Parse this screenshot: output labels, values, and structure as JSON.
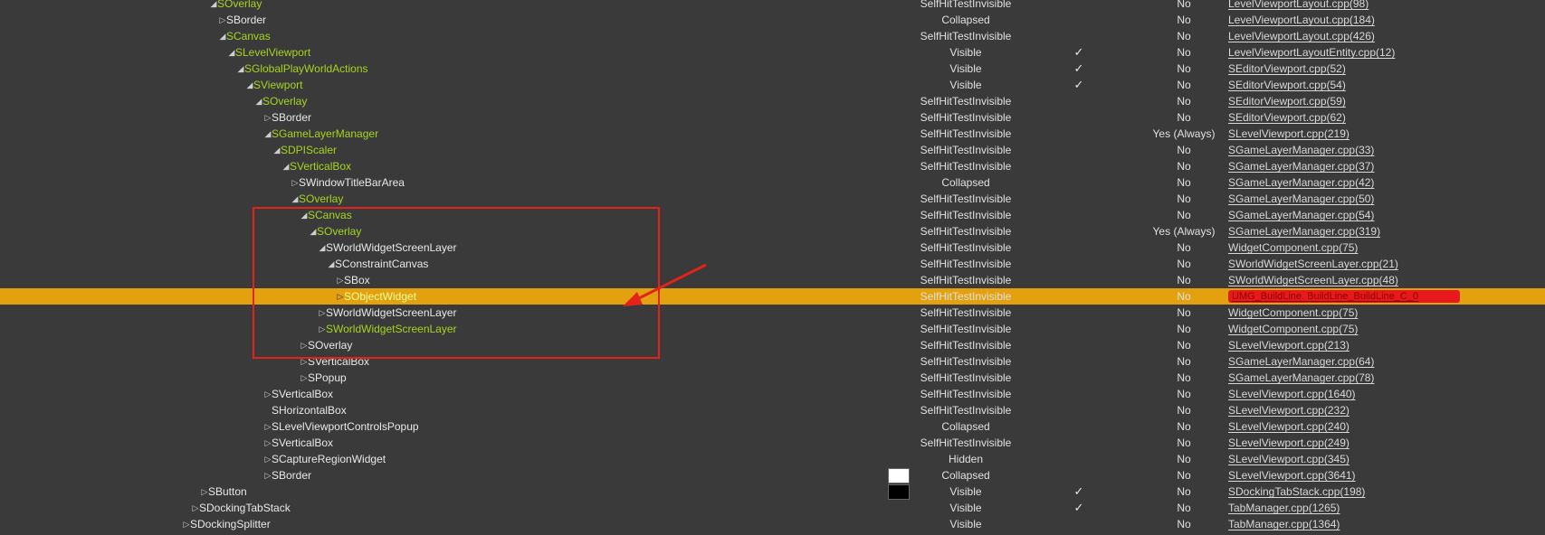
{
  "rows": [
    {
      "name": "SOverlay",
      "green": true,
      "level": 0,
      "exp": "down",
      "vis": "SelfHitTestInvisible",
      "check": "",
      "focus": "No",
      "src": "LevelViewportLayout.cpp(98)"
    },
    {
      "name": "SBorder",
      "green": false,
      "level": 1,
      "exp": "right",
      "vis": "Collapsed",
      "check": "",
      "focus": "No",
      "src": "LevelViewportLayout.cpp(184)"
    },
    {
      "name": "SCanvas",
      "green": true,
      "level": 1,
      "exp": "down",
      "vis": "SelfHitTestInvisible",
      "check": "",
      "focus": "No",
      "src": "LevelViewportLayout.cpp(426)"
    },
    {
      "name": "SLevelViewport",
      "green": true,
      "level": 2,
      "exp": "down",
      "vis": "Visible",
      "check": "✓",
      "focus": "No",
      "src": "LevelViewportLayoutEntity.cpp(12)"
    },
    {
      "name": "SGlobalPlayWorldActions",
      "green": true,
      "level": 3,
      "exp": "down",
      "vis": "Visible",
      "check": "✓",
      "focus": "No",
      "src": "SEditorViewport.cpp(52)"
    },
    {
      "name": "SViewport",
      "green": true,
      "level": 4,
      "exp": "down",
      "vis": "Visible",
      "check": "✓",
      "focus": "No",
      "src": "SEditorViewport.cpp(54)"
    },
    {
      "name": "SOverlay",
      "green": true,
      "level": 5,
      "exp": "down",
      "vis": "SelfHitTestInvisible",
      "check": "",
      "focus": "No",
      "src": "SEditorViewport.cpp(59)"
    },
    {
      "name": "SBorder",
      "green": false,
      "level": 6,
      "exp": "right",
      "vis": "SelfHitTestInvisible",
      "check": "",
      "focus": "No",
      "src": "SEditorViewport.cpp(62)"
    },
    {
      "name": "SGameLayerManager",
      "green": true,
      "level": 6,
      "exp": "down",
      "vis": "SelfHitTestInvisible",
      "check": "",
      "focus": "Yes (Always)",
      "src": "SLevelViewport.cpp(219)"
    },
    {
      "name": "SDPIScaler",
      "green": true,
      "level": 7,
      "exp": "down",
      "vis": "SelfHitTestInvisible",
      "check": "",
      "focus": "No",
      "src": "SGameLayerManager.cpp(33)"
    },
    {
      "name": "SVerticalBox",
      "green": true,
      "level": 8,
      "exp": "down",
      "vis": "SelfHitTestInvisible",
      "check": "",
      "focus": "No",
      "src": "SGameLayerManager.cpp(37)"
    },
    {
      "name": "SWindowTitleBarArea",
      "green": false,
      "level": 9,
      "exp": "right",
      "vis": "Collapsed",
      "check": "",
      "focus": "No",
      "src": "SGameLayerManager.cpp(42)"
    },
    {
      "name": "SOverlay",
      "green": true,
      "level": 9,
      "exp": "down",
      "vis": "SelfHitTestInvisible",
      "check": "",
      "focus": "No",
      "src": "SGameLayerManager.cpp(50)"
    },
    {
      "name": "SCanvas",
      "green": true,
      "level": 10,
      "exp": "down",
      "vis": "SelfHitTestInvisible",
      "check": "",
      "focus": "No",
      "src": "SGameLayerManager.cpp(54)"
    },
    {
      "name": "SOverlay",
      "green": true,
      "level": 11,
      "exp": "down",
      "vis": "SelfHitTestInvisible",
      "check": "",
      "focus": "Yes (Always)",
      "src": "SGameLayerManager.cpp(319)"
    },
    {
      "name": "SWorldWidgetScreenLayer",
      "green": false,
      "level": 12,
      "exp": "down",
      "vis": "SelfHitTestInvisible",
      "check": "",
      "focus": "No",
      "src": "WidgetComponent.cpp(75)"
    },
    {
      "name": "SConstraintCanvas",
      "green": false,
      "level": 13,
      "exp": "down",
      "vis": "SelfHitTestInvisible",
      "check": "",
      "focus": "No",
      "src": "SWorldWidgetScreenLayer.cpp(21)"
    },
    {
      "name": "SBox",
      "green": false,
      "level": 14,
      "exp": "right",
      "vis": "SelfHitTestInvisible",
      "check": "",
      "focus": "No",
      "src": "SWorldWidgetScreenLayer.cpp(48)"
    },
    {
      "name": "SObjectWidget",
      "green": true,
      "level": 14,
      "exp": "right",
      "vis": "SelfHitTestInvisible",
      "check": "",
      "focus": "No",
      "src": "UMG_BuildLine. BuildLine_BuildLine_C_0",
      "selected": true,
      "err": true
    },
    {
      "name": "SWorldWidgetScreenLayer",
      "green": false,
      "level": 12,
      "exp": "right",
      "vis": "SelfHitTestInvisible",
      "check": "",
      "focus": "No",
      "src": "WidgetComponent.cpp(75)"
    },
    {
      "name": "SWorldWidgetScreenLayer",
      "green": true,
      "level": 12,
      "exp": "right",
      "vis": "SelfHitTestInvisible",
      "check": "",
      "focus": "No",
      "src": "WidgetComponent.cpp(75)"
    },
    {
      "name": "SOverlay",
      "green": false,
      "level": 10,
      "exp": "right",
      "vis": "SelfHitTestInvisible",
      "check": "",
      "focus": "No",
      "src": "SLevelViewport.cpp(213)"
    },
    {
      "name": "SVerticalBox",
      "green": false,
      "level": 10,
      "exp": "right",
      "vis": "SelfHitTestInvisible",
      "check": "",
      "focus": "No",
      "src": "SGameLayerManager.cpp(64)"
    },
    {
      "name": "SPopup",
      "green": false,
      "level": 10,
      "exp": "right",
      "vis": "SelfHitTestInvisible",
      "check": "",
      "focus": "No",
      "src": "SGameLayerManager.cpp(78)"
    },
    {
      "name": "SVerticalBox",
      "green": false,
      "level": 6,
      "exp": "right",
      "vis": "SelfHitTestInvisible",
      "check": "",
      "focus": "No",
      "src": "SLevelViewport.cpp(1640)"
    },
    {
      "name": "SHorizontalBox",
      "green": false,
      "level": 6,
      "exp": "",
      "vis": "SelfHitTestInvisible",
      "check": "",
      "focus": "No",
      "src": "SLevelViewport.cpp(232)"
    },
    {
      "name": "SLevelViewportControlsPopup",
      "green": false,
      "level": 6,
      "exp": "right",
      "vis": "Collapsed",
      "check": "",
      "focus": "No",
      "src": "SLevelViewport.cpp(240)"
    },
    {
      "name": "SVerticalBox",
      "green": false,
      "level": 6,
      "exp": "right",
      "vis": "SelfHitTestInvisible",
      "check": "",
      "focus": "No",
      "src": "SLevelViewport.cpp(249)"
    },
    {
      "name": "SCaptureRegionWidget",
      "green": false,
      "level": 6,
      "exp": "right",
      "vis": "Hidden",
      "check": "",
      "focus": "No",
      "src": "SLevelViewport.cpp(345)"
    },
    {
      "name": "SBorder",
      "green": false,
      "level": 6,
      "exp": "right",
      "vis": "Collapsed",
      "check": "",
      "focus": "No",
      "src": "SLevelViewport.cpp(3641)",
      "swatch": "#ffffff"
    },
    {
      "name": "SButton",
      "green": false,
      "level": -1,
      "exp": "right",
      "vis": "Visible",
      "check": "✓",
      "focus": "No",
      "src": "SDockingTabStack.cpp(198)",
      "swatch": "#000000"
    },
    {
      "name": "SDockingTabStack",
      "green": false,
      "level": -2,
      "exp": "right",
      "vis": "Visible",
      "check": "✓",
      "focus": "No",
      "src": "TabManager.cpp(1265)"
    },
    {
      "name": "SDockingSplitter",
      "green": false,
      "level": -3,
      "exp": "right",
      "vis": "Visible",
      "check": "",
      "focus": "No",
      "src": "TabManager.cpp(1364)"
    }
  ],
  "colors": {
    "selected_row": "#e3a10f",
    "green_text": "#a6d421",
    "annotation": "#e3231a"
  }
}
